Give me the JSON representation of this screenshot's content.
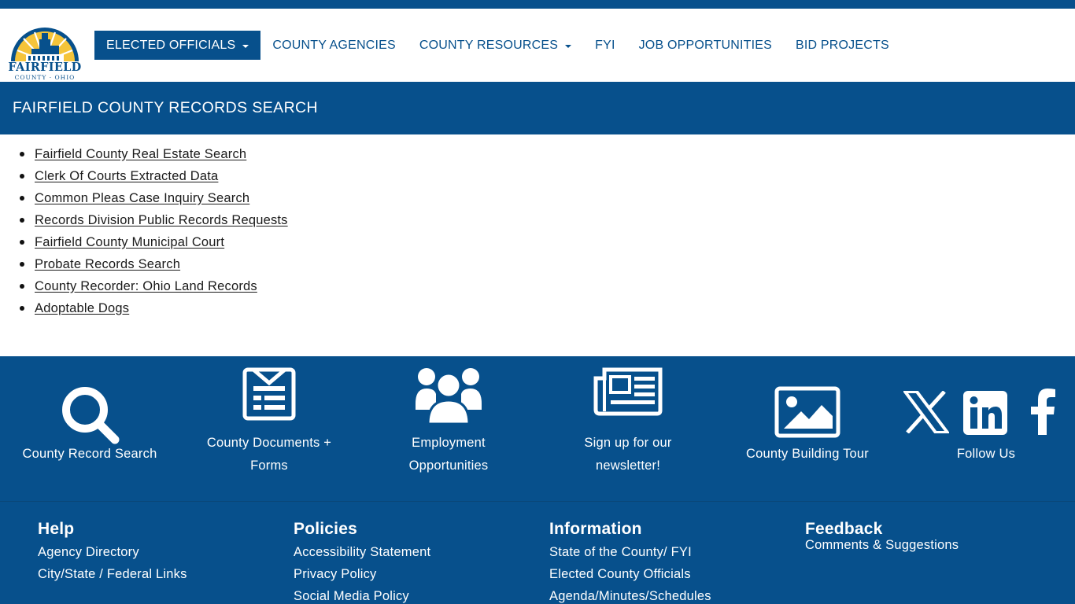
{
  "brand": {
    "name": "FAIRFIELD",
    "sub": "COUNTY · OHIO",
    "primary_color": "#07508c",
    "accent_color": "#f5c43a"
  },
  "nav": {
    "items": [
      {
        "label": "ELECTED OFFICIALS",
        "dropdown": true,
        "active": true
      },
      {
        "label": "COUNTY AGENCIES",
        "dropdown": false,
        "active": false
      },
      {
        "label": "COUNTY RESOURCES",
        "dropdown": true,
        "active": false
      },
      {
        "label": "FYI",
        "dropdown": false,
        "active": false
      },
      {
        "label": "JOB OPPORTUNITIES",
        "dropdown": false,
        "active": false
      },
      {
        "label": "BID PROJECTS",
        "dropdown": false,
        "active": false
      }
    ]
  },
  "page": {
    "title": "FAIRFIELD COUNTY RECORDS SEARCH"
  },
  "links": [
    "Fairfield County Real Estate Search",
    "Clerk Of Courts Extracted Data",
    "Common Pleas Case Inquiry Search",
    "Records Division Public Records Requests",
    "Fairfield County Municipal Court",
    "Probate Records Search",
    "County Recorder: Ohio Land Records",
    "Adoptable Dogs"
  ],
  "quick_links": {
    "record_search": {
      "line1": "County Record Search",
      "icon": "search-icon"
    },
    "documents": {
      "line1": "County Documents +",
      "line2": "Forms",
      "icon": "document-icon"
    },
    "employment": {
      "line1": "Employment",
      "line2": "Opportunities",
      "icon": "people-icon"
    },
    "newsletter": {
      "line1": "Sign up for our",
      "line2": "newsletter!",
      "icon": "newspaper-icon"
    },
    "building_tour": {
      "line1": "County Building Tour",
      "icon": "image-icon"
    },
    "follow": {
      "line1": "Follow Us",
      "icons": [
        "x-icon",
        "linkedin-icon",
        "facebook-icon"
      ]
    }
  },
  "footer": {
    "help": {
      "heading": "Help",
      "links": [
        "Agency Directory",
        "City/State / Federal Links"
      ]
    },
    "policies": {
      "heading": "Policies",
      "links": [
        "Accessibility Statement",
        "Privacy Policy",
        "Social Media Policy"
      ]
    },
    "information": {
      "heading": "Information",
      "links": [
        "State of the County/ FYI",
        "Elected County Officials",
        "Agenda/Minutes/Schedules"
      ]
    },
    "feedback": {
      "heading": "Feedback",
      "links": [
        "Comments & Suggestions"
      ]
    }
  }
}
